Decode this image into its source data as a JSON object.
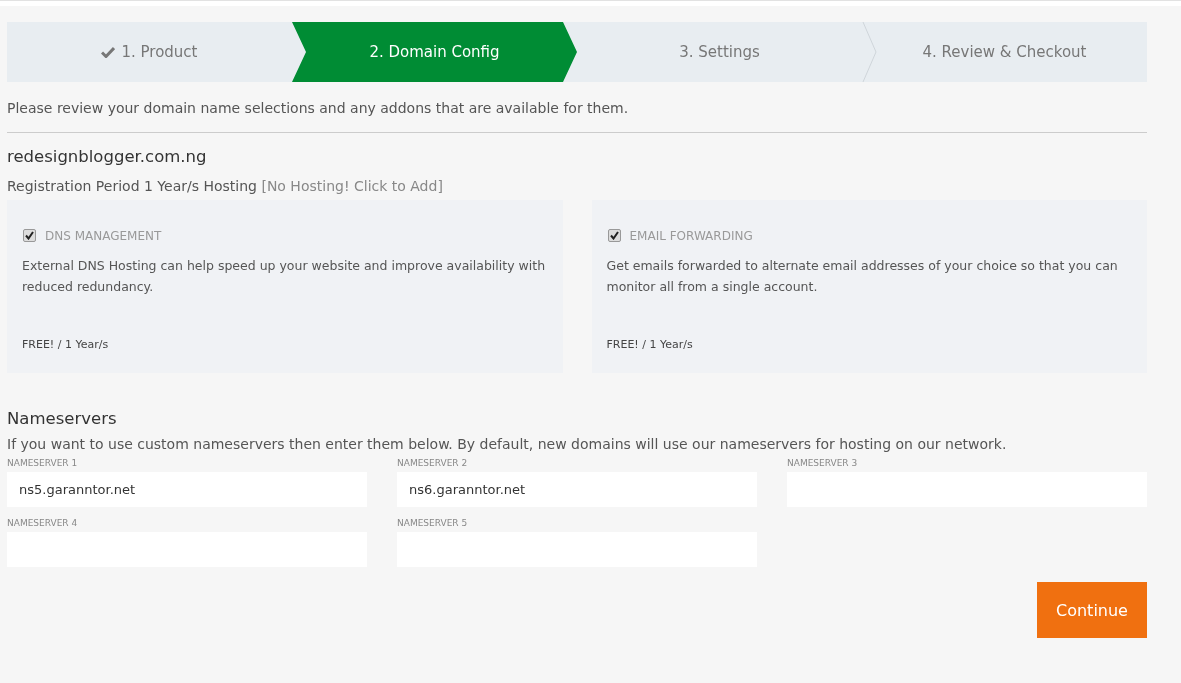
{
  "steps": [
    {
      "label": "1. Product",
      "done": true,
      "selected": false
    },
    {
      "label": "2. Domain Config",
      "done": false,
      "selected": true
    },
    {
      "label": "3. Settings",
      "done": false,
      "selected": false
    },
    {
      "label": "4. Review & Checkout",
      "done": false,
      "selected": false
    }
  ],
  "intro": "Please review your domain name selections and any addons that are available for them.",
  "domain": {
    "name": "redesignblogger.com.ng",
    "registration": "Registration Period 1 Year/s Hosting",
    "hosting_link": "[No Hosting! Click to Add]"
  },
  "addons": [
    {
      "title": "DNS MANAGEMENT",
      "checked": true,
      "description": "External DNS Hosting can help speed up your website and improve availability with reduced redundancy.",
      "price": "FREE! / 1 Year/s"
    },
    {
      "title": "EMAIL FORWARDING",
      "checked": true,
      "description": "Get emails forwarded to alternate email addresses of your choice so that you can monitor all from a single account.",
      "price": "FREE! / 1 Year/s"
    }
  ],
  "nameservers": {
    "title": "Nameservers",
    "description": "If you want to use custom nameservers then enter them below. By default, new domains will use our nameservers for hosting on our network.",
    "fields": [
      {
        "label": "NAMESERVER 1",
        "value": "ns5.garanntor.net"
      },
      {
        "label": "NAMESERVER 2",
        "value": "ns6.garanntor.net"
      },
      {
        "label": "NAMESERVER 3"
      },
      {
        "label": "NAMESERVER 4"
      },
      {
        "label": "NAMESERVER 5"
      }
    ]
  },
  "continue_button": "Continue"
}
